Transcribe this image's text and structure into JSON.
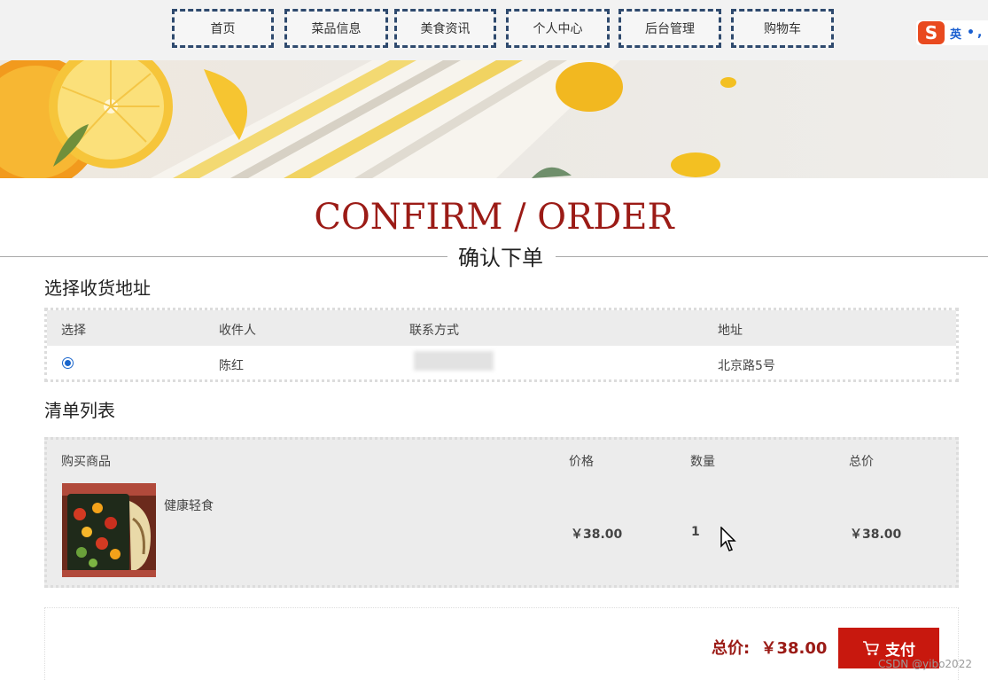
{
  "nav": {
    "items": [
      {
        "label": "首页"
      },
      {
        "label": "菜品信息"
      },
      {
        "label": "美食资讯"
      },
      {
        "label": "个人中心"
      },
      {
        "label": "后台管理"
      },
      {
        "label": "购物车"
      }
    ]
  },
  "ime": {
    "logo": "S",
    "lang": "英",
    "dots": "•,"
  },
  "heading": {
    "title_en": "CONFIRM / ORDER",
    "title_cn": "确认下单"
  },
  "address_section": {
    "title": "选择收货地址",
    "columns": [
      "选择",
      "收件人",
      "联系方式",
      "地址"
    ],
    "rows": [
      {
        "selected": true,
        "recipient": "陈红",
        "contact": "",
        "address": "北京路5号"
      }
    ]
  },
  "order_section": {
    "title": "清单列表",
    "columns": [
      "购买商品",
      "价格",
      "数量",
      "总价"
    ],
    "items": [
      {
        "name": "健康轻食",
        "price": "￥38.00",
        "quantity": "1",
        "total": "￥38.00"
      }
    ]
  },
  "summary": {
    "total_label": "总价:",
    "total_value": "￥38.00",
    "pay_label": "支付"
  },
  "watermark": "CSDN @yibo2022",
  "colors": {
    "accent": "#9b1b16",
    "pay_button": "#c8180e",
    "nav_border": "#2f4a6e"
  }
}
